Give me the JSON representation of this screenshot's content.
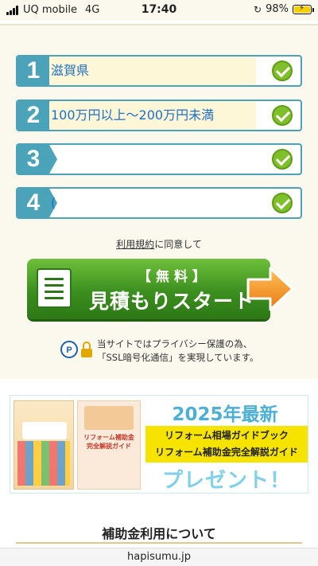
{
  "status_bar": {
    "carrier": "UQ mobile",
    "network": "4G",
    "time": "17:40",
    "battery": "98%",
    "battery_level": 0.98
  },
  "steps": [
    {
      "number": "1",
      "value": "滋賀県"
    },
    {
      "number": "2",
      "value": "100万円以上〜200万円未満"
    },
    {
      "number": "3",
      "value": ""
    },
    {
      "number": "4",
      "value": "("
    }
  ],
  "terms": {
    "link_label": "利用規約",
    "suffix": "に同意して"
  },
  "cta": {
    "small_label": "【 無 料 】",
    "main_label": "見積もりスタート"
  },
  "ssl_notice": {
    "line1": "当サイトではプライバシー保護の為、",
    "line2": "「SSL暗号化通信」を実現しています。"
  },
  "banner": {
    "headline": "2025年最新",
    "line1": "リフォーム相場ガイドブック",
    "line2": "リフォーム補助金完全解説ガイド",
    "present": "プレゼント！",
    "book2_title": "リフォーム補助金完全解説ガイド"
  },
  "section_title": "補助金利用について",
  "url": "hapisumu.jp",
  "colors": {
    "accent": "#4aa3b8",
    "cta_green": "#3b8f1f",
    "check": "#7fbf2a",
    "arrow": "#f0901e"
  }
}
